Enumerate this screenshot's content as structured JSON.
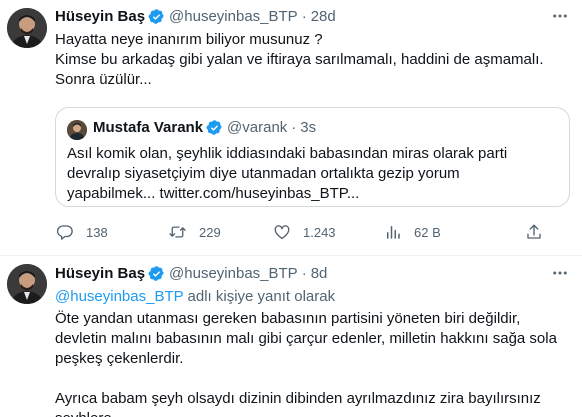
{
  "tweet1": {
    "author_name": "Hüseyin Baş",
    "handle": "@huseyinbas_BTP",
    "time": "28d",
    "lines": [
      "Hayatta neye inanırım biliyor musunuz ?",
      "Kimse bu arkadaş gibi yalan ve iftiraya sarılmamalı, haddini de aşmamalı.",
      "Sonra üzülür..."
    ],
    "quote": {
      "author_name": "Mustafa Varank",
      "handle": "@varank",
      "time": "3s",
      "lines": [
        "Asıl komik olan, şeyhlik iddiasındaki babasından miras olarak parti",
        "devralıp siyasetçiyim diye utanmadan ortalıkta gezip yorum",
        "yapabilmek... twitter.com/huseyinbas_BTP..."
      ]
    },
    "actions": {
      "replies": "138",
      "retweets": "229",
      "likes": "1.243",
      "views": "62 B"
    }
  },
  "tweet2": {
    "author_name": "Hüseyin Baş",
    "handle": "@huseyinbas_BTP",
    "time": "8d",
    "reply_mention": "@huseyinbas_BTP",
    "reply_suffix": " adlı kişiye yanıt olarak",
    "lines": [
      "Öte yandan utanması gereken babasının partisini yöneten biri değildir,",
      "devletin malını babasının malı gibi çarçur edenler, milletin hakkını sağa sola",
      "peşkeş çekenlerdir."
    ],
    "lines2": [
      "Ayrıca babam şeyh olsaydı dizinin dibinden ayrılmazdınız zira bayılırsınız",
      "şeyhlere..."
    ]
  },
  "colors": {
    "text": "#0f1419",
    "secondary": "#536471",
    "accent": "#1d9bf0",
    "border": "#cfd9de"
  }
}
